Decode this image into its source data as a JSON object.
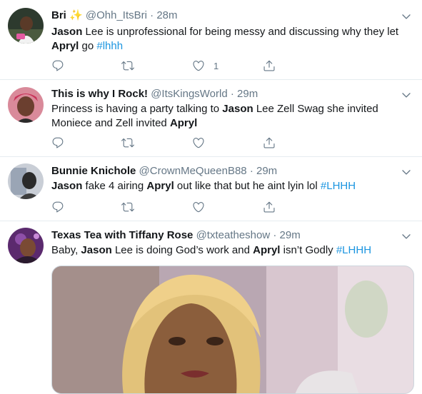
{
  "tweets": [
    {
      "name": "Bri",
      "sparkle": "✨",
      "handle": "@Ohh_ItsBri",
      "dot": "·",
      "time": "28m",
      "text": {
        "p1": "Jason",
        "p2": " Lee is unprofessional for being messy and discussing why they let ",
        "p3": "Apryl",
        "p4": " go ",
        "tag": "#lhhh"
      },
      "like_count": "1"
    },
    {
      "name": "This is why I Rock!",
      "handle": "@ItsKingsWorld",
      "dot": "·",
      "time": "29m",
      "text": {
        "p1": "Princess is having a party talking to ",
        "p2": "Jason",
        "p3": " Lee Zell Swag she invited Moniece and Zell invited ",
        "p4": "Apryl"
      }
    },
    {
      "name": "Bunnie Knichole",
      "handle": "@CrownMeQueenB88",
      "dot": "·",
      "time": "29m",
      "text": {
        "p1": "Jason",
        "p2": " fake 4 airing ",
        "p3": "Apryl",
        "p4": " out like that but he aint lyin lol ",
        "tag": "#LHHH"
      }
    },
    {
      "name": "Texas Tea with Tiffany Rose",
      "handle": "@txteatheshow",
      "dot": "·",
      "time": "29m",
      "text": {
        "p1": "Baby, ",
        "p2": "Jason",
        "p3": " Lee is doing God’s work and ",
        "p4": "Apryl",
        "p5": " isn’t Godly ",
        "tag": "#LHHH"
      }
    }
  ],
  "icons": {
    "reply": "reply-icon",
    "retweet": "retweet-icon",
    "like": "heart-icon",
    "share": "share-icon",
    "more": "chevron-down-icon"
  },
  "colors": {
    "text": "#14171a",
    "secondary": "#657786",
    "link": "#1b95e0",
    "divider": "#e6ecf0"
  }
}
